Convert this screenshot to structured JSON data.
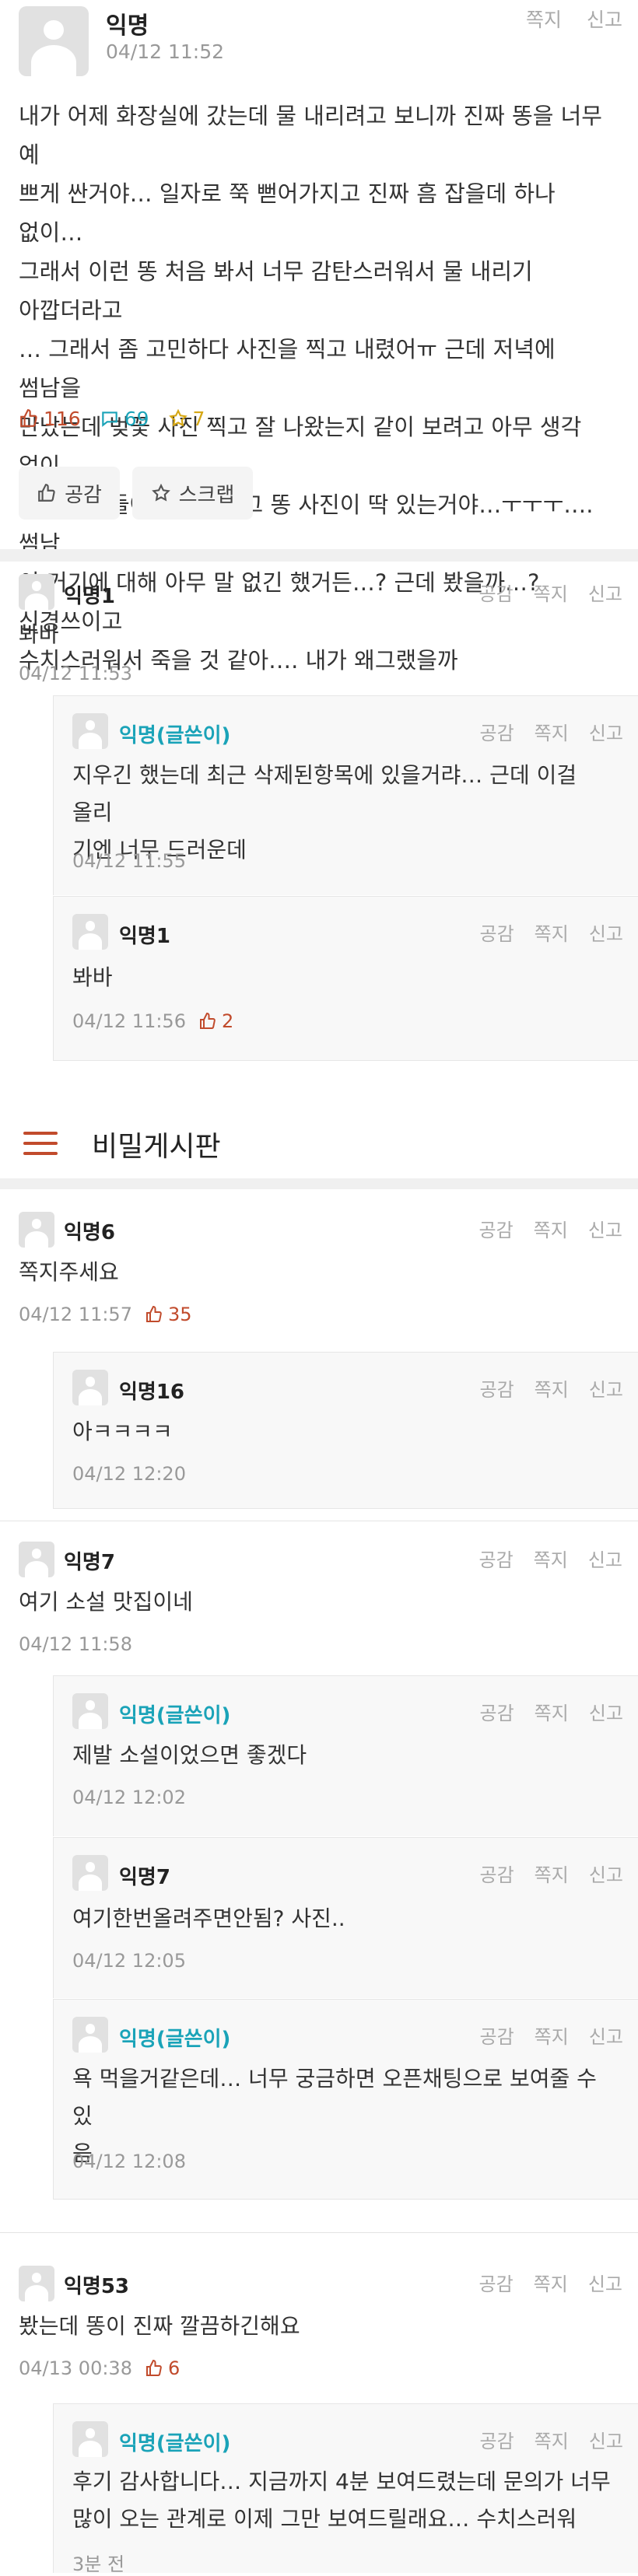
{
  "post": {
    "author": "익명",
    "time": "04/12 11:52",
    "actions": [
      "쪽지",
      "신고"
    ],
    "lines": [
      "내가 어제 화장실에 갔는데 물 내리려고 보니까 진짜 똥을 너무 예",
      "쁘게 싼거야… 일자로 쭉 뻗어가지고 진짜 흠 잡을데 하나 없이…",
      "그래서 이런 똥 처음 봐서 너무 감탄스러워서 물 내리기 아깝더라고",
      "… 그래서 좀 고민하다 사진을 찍고 내렸어ㅠ 근데 저녁에 썸남을",
      "만났는데 벚꽃 사진 찍고 잘 나왔는지 같이 보려고 아무 생각 없이",
      "갤러리에 들어갔는데… 그 똥 사진이 딱 있는거야…ㅜㅜㅜ…. 썸남",
      "이 거기에 대해 아무 말 없긴 했거든…? 근데 봤을까…? 신경쓰이고",
      "수치스러워서 죽을 것 같아…. 내가 왜그랬을까"
    ],
    "likes": "116",
    "comments": "69",
    "scraps": "7",
    "empathy_button": "공감",
    "scrap_button": "스크랩"
  },
  "comment_actions": [
    "공감",
    "쪽지",
    "신고"
  ],
  "comments": [
    {
      "name": "익명1",
      "text": "봐바",
      "time": "04/12 11:53",
      "likes": ""
    },
    {
      "name": "익명(글쓴이)",
      "text1": "지우긴 했는데 최근 삭제된항목에 있을거랴… 근데 이걸 올리",
      "text2": "기엔 너무 드러운데",
      "time": "04/12 11:55"
    },
    {
      "name": "익명1",
      "text": "봐바",
      "time": "04/12 11:56",
      "likes": "2"
    },
    {
      "name": "익명6",
      "text": "쪽지주세요",
      "time": "04/12 11:57",
      "likes": "35"
    },
    {
      "name": "익명16",
      "text": "아ㅋㅋㅋㅋ",
      "time": "04/12 12:20"
    },
    {
      "name": "익명7",
      "text": "여기 소설 맛집이네",
      "time": "04/12 11:58"
    },
    {
      "name": "익명(글쓴이)",
      "text": "제발 소설이었으면 좋겠다",
      "time": "04/12 12:02"
    },
    {
      "name": "익명7",
      "text": "여기한번올려주면안됨? 사진..",
      "time": "04/12 12:05"
    },
    {
      "name": "익명(글쓴이)",
      "text1": "욕 먹을거같은데… 너무 궁금하면 오픈채팅으로 보여줄 수 있",
      "text2": "음",
      "time": "04/12 12:08"
    },
    {
      "name": "익명53",
      "text": "봤는데 똥이 진짜 깔끔하긴해요",
      "time": "04/13 00:38",
      "likes": "6"
    },
    {
      "name": "익명(글쓴이)",
      "text1": "후기 감사합니다… 지금까지 4분 보여드렸는데 문의가 너무",
      "text2": "많이 오는 관계로 이제 그만 보여드릴래요… 수치스러워",
      "time": "3분 전"
    }
  ],
  "board": {
    "title": "비밀게시판"
  },
  "colors": {
    "like": "#c14b2c",
    "comment": "#1aa3b8",
    "scrap": "#d6a816",
    "writer": "#1aa3b8"
  }
}
